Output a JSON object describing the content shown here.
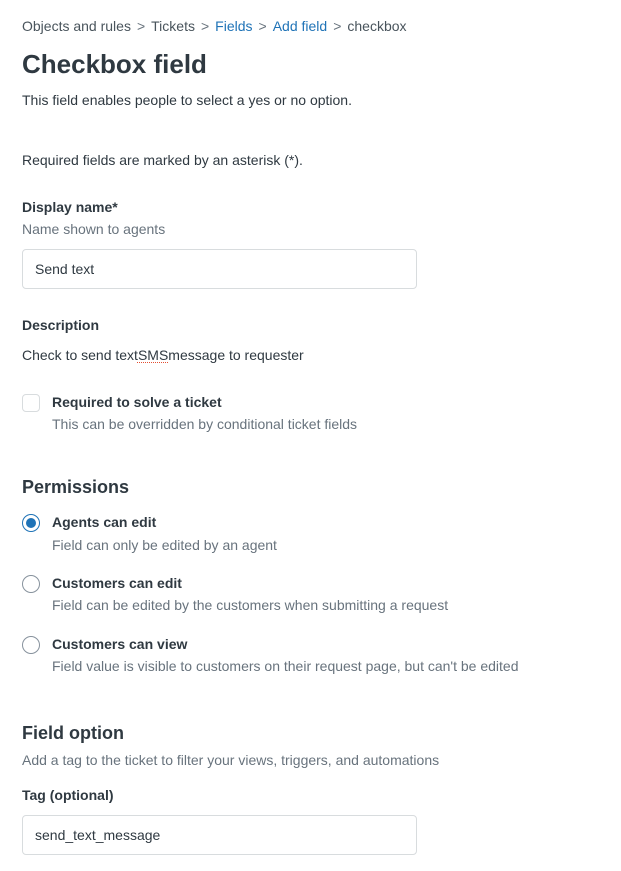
{
  "breadcrumb": {
    "objects": "Objects and rules",
    "tickets": "Tickets",
    "fields": "Fields",
    "add_field": "Add field",
    "checkbox": "checkbox",
    "sep": ">"
  },
  "page": {
    "title": "Checkbox field",
    "subtitle": "This field enables people to select a yes or no option.",
    "required_note": "Required fields are marked by an asterisk (*)."
  },
  "display_name": {
    "label": "Display name*",
    "help": "Name shown to agents",
    "value": "Send text"
  },
  "description": {
    "label": "Description",
    "value_pre": "Check to send text ",
    "value_sms": "SMS",
    "value_post": " message to requester"
  },
  "required_solve": {
    "title": "Required to solve a ticket",
    "desc": "This can be overridden by conditional ticket fields"
  },
  "permissions": {
    "title": "Permissions",
    "options": [
      {
        "title": "Agents can edit",
        "desc": "Field can only be edited by an agent",
        "checked": true
      },
      {
        "title": "Customers can edit",
        "desc": "Field can be edited by the customers when submitting a request",
        "checked": false
      },
      {
        "title": "Customers can view",
        "desc": "Field value is visible to customers on their request page, but can't be edited",
        "checked": false
      }
    ]
  },
  "field_option": {
    "title": "Field option",
    "sub": "Add a tag to the ticket to filter your views, triggers, and automations",
    "tag_label": "Tag (optional)",
    "tag_value": "send_text_message"
  }
}
